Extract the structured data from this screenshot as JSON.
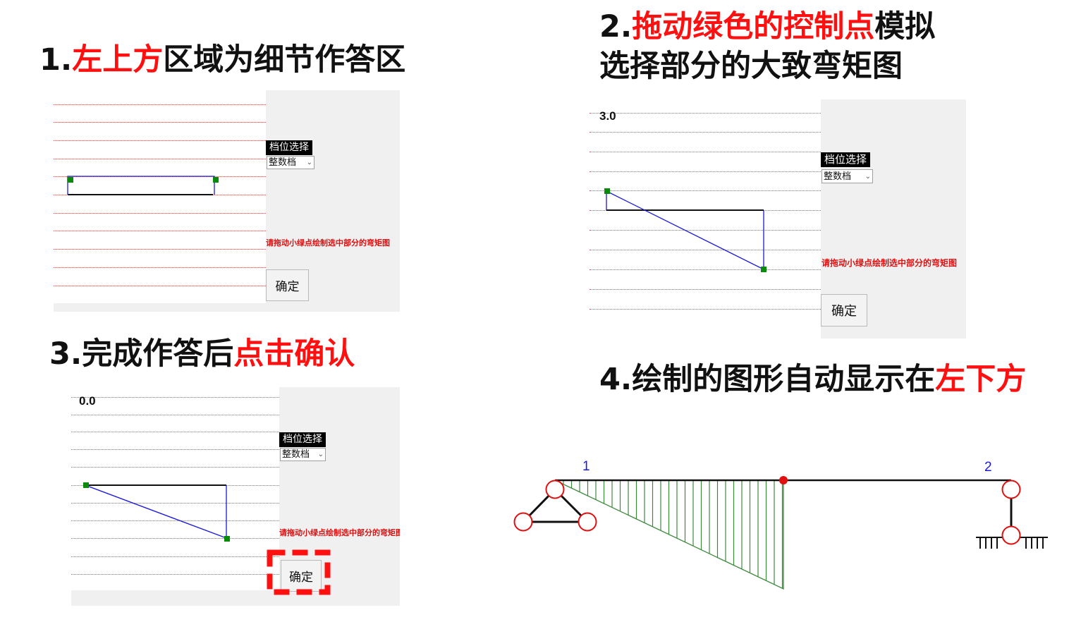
{
  "steps": [
    {
      "num": "1.",
      "parts": [
        {
          "text": "左上方",
          "red": true
        },
        {
          "text": "区域为细节作答区",
          "red": false
        }
      ]
    },
    {
      "num": "2.",
      "line1": [
        {
          "text": "拖动绿色的控制点",
          "red": true
        },
        {
          "text": "模拟",
          "red": false
        }
      ],
      "line2": "选择部分的大致弯矩图"
    },
    {
      "num": "3.",
      "parts": [
        {
          "text": "完成作答后",
          "red": false
        },
        {
          "text": "点击确认",
          "red": true
        }
      ]
    },
    {
      "num": "4.",
      "parts": [
        {
          "text": "绘制的图形自动显示在",
          "red": false
        },
        {
          "text": "左下方",
          "red": true
        }
      ]
    }
  ],
  "panel": {
    "gear_label": "档位选择",
    "gear_value": "整数档",
    "hint": "请拖动小绿点绘制选中部分的弯矩图",
    "confirm_label": "确定"
  },
  "panels": {
    "p2": {
      "value": "3.0"
    },
    "p3": {
      "value": "0.0"
    }
  },
  "structure": {
    "node1_label": "1",
    "node2_label": "2"
  },
  "colors": {
    "accent_red": "#ff1010",
    "control_point_green": "#0a8a0a",
    "moment_line_blue": "#1a1adc",
    "moment_fill_green": "#3d8a3d",
    "gridline_red": "#e24848",
    "panel_gray": "#f0f0f0"
  }
}
